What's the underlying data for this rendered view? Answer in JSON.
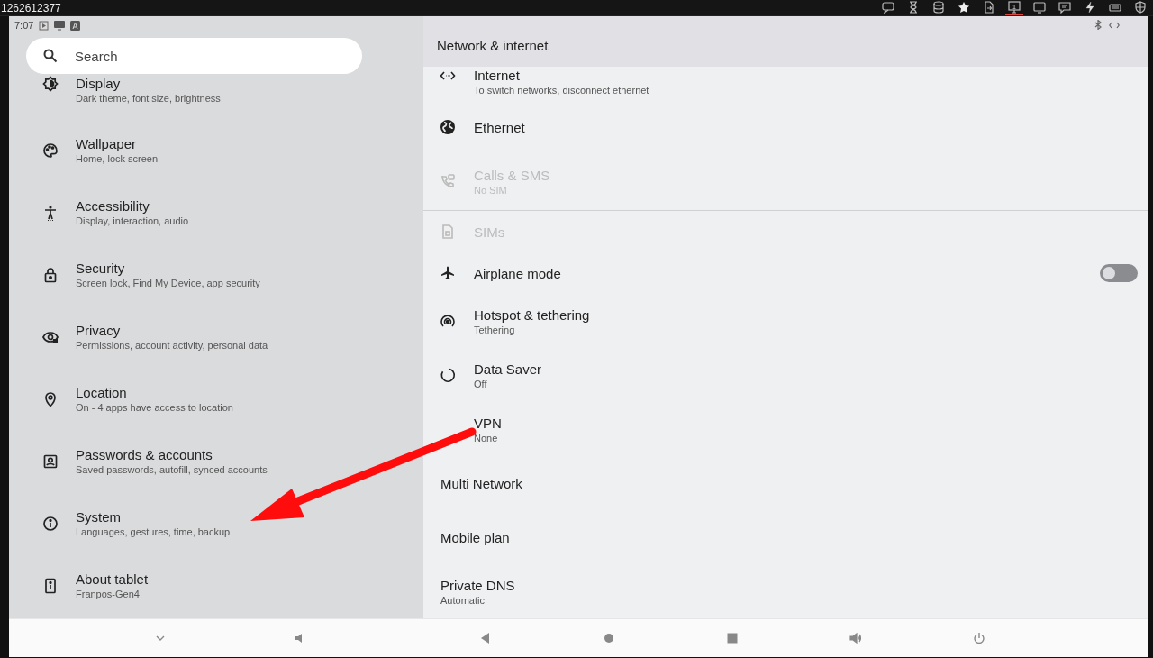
{
  "window": {
    "title": "1262612377"
  },
  "toolbar": [
    {
      "selected": false
    },
    {
      "selected": false
    },
    {
      "selected": false
    },
    {
      "selected": false
    },
    {
      "selected": false
    },
    {
      "label": "1",
      "selected": true
    },
    {
      "selected": false
    },
    {
      "selected": false
    },
    {
      "selected": false
    },
    {
      "selected": false
    },
    {
      "selected": false
    }
  ],
  "status_bar": {
    "time": "7:07"
  },
  "search": {
    "placeholder": "Search"
  },
  "sidebar": {
    "items": [
      {
        "title": "Display",
        "subtitle": "Dark theme, font size, brightness"
      },
      {
        "title": "Wallpaper",
        "subtitle": "Home, lock screen"
      },
      {
        "title": "Accessibility",
        "subtitle": "Display, interaction, audio"
      },
      {
        "title": "Security",
        "subtitle": "Screen lock, Find My Device, app security"
      },
      {
        "title": "Privacy",
        "subtitle": "Permissions, account activity, personal data"
      },
      {
        "title": "Location",
        "subtitle": "On - 4 apps have access to location"
      },
      {
        "title": "Passwords & accounts",
        "subtitle": "Saved passwords, autofill, synced accounts"
      },
      {
        "title": "System",
        "subtitle": "Languages, gestures, time, backup"
      },
      {
        "title": "About tablet",
        "subtitle": "Franpos-Gen4"
      }
    ]
  },
  "detail": {
    "title": "Network & internet",
    "groups": [
      [
        {
          "title": "Internet",
          "subtitle": "To switch networks, disconnect ethernet",
          "disabled": false
        },
        {
          "title": "Ethernet",
          "disabled": false
        },
        {
          "title": "Calls & SMS",
          "subtitle": "No SIM",
          "disabled": true
        }
      ],
      [
        {
          "title": "SIMs",
          "disabled": true
        },
        {
          "title": "Airplane mode",
          "disabled": false,
          "toggle": {
            "on": false
          }
        },
        {
          "title": "Hotspot & tethering",
          "subtitle": "Tethering",
          "disabled": false
        },
        {
          "title": "Data Saver",
          "subtitle": "Off",
          "disabled": false
        },
        {
          "title": "VPN",
          "subtitle": "None",
          "disabled": false
        },
        {
          "title": "Multi Network",
          "disabled": false
        },
        {
          "title": "Mobile plan",
          "disabled": false
        },
        {
          "title": "Private DNS",
          "subtitle": "Automatic",
          "disabled": false
        }
      ]
    ]
  }
}
